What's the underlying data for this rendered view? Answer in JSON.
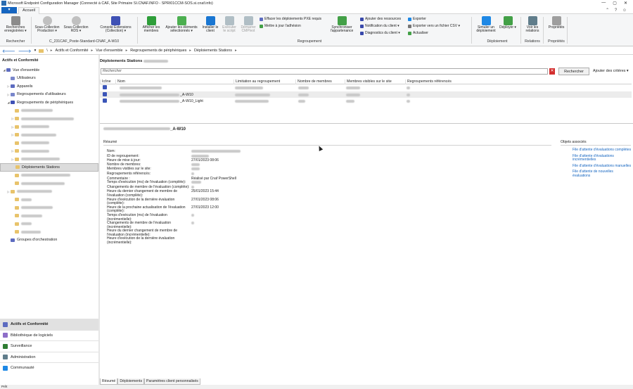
{
  "window": {
    "title": "Microsoft Endpoint Configuration Manager (Connecté à CAF, Site Primaire SI.CNAF.INFO - SPRI01CCM-SOS.si.cnaf.info)",
    "controls": [
      "—",
      "▢",
      "✕"
    ]
  },
  "ribbon_tabs": {
    "file": "▾",
    "home": "Accueil"
  },
  "ribbon": {
    "buttons": [
      {
        "label": "Recherches enregistrées ▾",
        "icon": "saved-search-icon",
        "color": "#8b8b8b"
      },
      {
        "label": "Sous-Collection Production ▾",
        "icon": "subcollection-icon",
        "color": "#c0c0c0"
      },
      {
        "label": "Sous-Collection RDS ▾",
        "icon": "subcollection-rds-icon",
        "color": "#c0c0c0"
      },
      {
        "label": "Console Extensions (Collection) ▾",
        "icon": "console-extensions-icon",
        "color": "#3f51b5"
      },
      {
        "label": "Afficher les membres",
        "icon": "show-members-icon",
        "color": "#2e9e3a"
      },
      {
        "label": "Ajouter les éléments sélectionnés ▾",
        "icon": "add-items-icon",
        "color": "#4caf50"
      },
      {
        "label": "Installer le client",
        "icon": "install-client-icon",
        "color": "#1976d2"
      },
      {
        "label": "Exécuter le script",
        "icon": "run-script-icon",
        "color": "#b0bec5"
      },
      {
        "label": "Démarrer CMPivot",
        "icon": "cmpivot-icon",
        "color": "#b0bec5"
      },
      {
        "label": "Synchroniser l'appartenance",
        "icon": "sync-icon",
        "color": "#43a047"
      },
      {
        "label": "Simuler un déploiement",
        "icon": "simulate-icon",
        "color": "#1e88e5"
      },
      {
        "label": "Déployer ▾",
        "icon": "deploy-icon",
        "color": "#43a047"
      },
      {
        "label": "Voir les relations",
        "icon": "relations-icon",
        "color": "#607d8b"
      },
      {
        "label": "Propriétés",
        "icon": "properties-icon",
        "color": "#9e9e9e"
      }
    ],
    "small": [
      {
        "label": "Effacer les déploiements PXE requis",
        "icon": "pxe-icon",
        "color": "#5c6bc0"
      },
      {
        "label": "Mettre à jour l'adhésion",
        "icon": "update-icon",
        "color": "#43a047"
      },
      {
        "label": "Ajouter des ressources",
        "icon": "add-resources-icon",
        "color": "#3949ab"
      },
      {
        "label": "Notification du client ▾",
        "icon": "notify-icon",
        "color": "#3949ab"
      },
      {
        "label": "Diagnostics du client ▾",
        "icon": "diagnostics-icon",
        "color": "#3949ab"
      },
      {
        "label": "Exporter",
        "icon": "export-icon",
        "color": "#1e88e5"
      },
      {
        "label": "Exporter vers un fichier CSV ▾",
        "icon": "csv-icon",
        "color": "#757575"
      },
      {
        "label": "Actualiser",
        "icon": "refresh-icon",
        "color": "#43a047"
      }
    ],
    "groups": [
      "Rechercher",
      "Regroupement",
      "Déploiement",
      "Relations",
      "Propriétés"
    ],
    "context": "C_231CAF_Poste-Standard-CNAF_A-W10"
  },
  "addressbar": {
    "path": [
      "\\",
      "Actifs et Conformité",
      "Vue d'ensemble",
      "Regroupements de périphériques",
      "Déploiements Stations"
    ]
  },
  "left": {
    "header": "Actifs et Conformité",
    "tree": [
      {
        "label": "Vue d'ensemble",
        "indent": 0,
        "arrow": "◢",
        "color": "#5c6bc0"
      },
      {
        "label": "Utilisateurs",
        "indent": 1,
        "arrow": "",
        "color": "#7986cb"
      },
      {
        "label": "Appareils",
        "indent": 1,
        "arrow": "▷",
        "color": "#5c6bc0"
      },
      {
        "label": "Regroupements d'utilisateurs",
        "indent": 1,
        "arrow": "▷",
        "color": "#7986cb"
      },
      {
        "label": "Regroupements de périphériques",
        "indent": 1,
        "arrow": "◢",
        "color": "#3f51b5"
      },
      {
        "label": "",
        "indent": 2,
        "arrow": "",
        "folder": true,
        "blur": 45
      },
      {
        "label": "",
        "indent": 2,
        "arrow": "▷",
        "folder": true,
        "blur": 75
      },
      {
        "label": "",
        "indent": 2,
        "arrow": "▷",
        "folder": true,
        "blur": 40
      },
      {
        "label": "",
        "indent": 2,
        "arrow": "▷",
        "folder": true,
        "blur": 50
      },
      {
        "label": "",
        "indent": 2,
        "arrow": "",
        "folder": true,
        "blur": 40
      },
      {
        "label": "",
        "indent": 2,
        "arrow": "▷",
        "folder": true,
        "blur": 40
      },
      {
        "label": "",
        "indent": 2,
        "arrow": "▷",
        "folder": true,
        "blur": 55
      },
      {
        "label": "Déploiements Stations",
        "indent": 2,
        "arrow": "",
        "folder": true,
        "selected": true
      },
      {
        "label": "",
        "indent": 2,
        "arrow": "",
        "folder": true,
        "blur": 70
      },
      {
        "label": "",
        "indent": 2,
        "arrow": "",
        "folder": true,
        "blur": 62
      },
      {
        "label": "",
        "indent": 1,
        "arrow": "▷",
        "folder": true,
        "blur": 50
      },
      {
        "label": "",
        "indent": 2,
        "arrow": "",
        "folder": true,
        "blur": 15
      },
      {
        "label": "",
        "indent": 2,
        "arrow": "",
        "folder": true,
        "blur": 45
      },
      {
        "label": "",
        "indent": 2,
        "arrow": "",
        "folder": true,
        "blur": 30
      },
      {
        "label": "",
        "indent": 2,
        "arrow": "",
        "folder": true,
        "blur": 15
      },
      {
        "label": "",
        "indent": 2,
        "arrow": "",
        "folder": true,
        "blur": 28
      },
      {
        "label": "Groupes d'orchestration",
        "indent": 1,
        "arrow": "",
        "color": "#5c6bc0"
      }
    ],
    "workspaces": [
      {
        "label": "Actifs et Conformité",
        "color": "#5c6bc0",
        "selected": true
      },
      {
        "label": "Bibliothèque de logiciels",
        "color": "#8e6ec8"
      },
      {
        "label": "Surveillance",
        "color": "#2e7d32"
      },
      {
        "label": "Administration",
        "color": "#607d8b"
      },
      {
        "label": "Communauté",
        "color": "#1e88e5"
      }
    ]
  },
  "main": {
    "title": "Déploiements Stations",
    "search_placeholder": "Rechercher",
    "search_clear": "✕",
    "search_button": "Rechercher",
    "add_criteria": "Ajouter des critères ▾",
    "columns": [
      "Icône",
      "Nom",
      "Limitation au regroupement",
      "Nombre de membres",
      "Membres visibles sur le site",
      "Regroupements référencés"
    ],
    "rows": [
      {
        "name_suffix": "",
        "b": [
          60,
          40,
          15,
          20,
          5
        ]
      },
      {
        "name_suffix": "_A-W10",
        "b": [
          85,
          50,
          15,
          20,
          5
        ]
      },
      {
        "name_suffix": "_A-W10_Light",
        "b": [
          85,
          48,
          10,
          12,
          5
        ]
      }
    ],
    "detail": {
      "title_suffix": "_A-W10",
      "section": "Résumé",
      "props": [
        {
          "label": "Nom:",
          "value": "",
          "blur": 70
        },
        {
          "label": "ID de regroupement:",
          "value": "",
          "blur": 25
        },
        {
          "label": "Heure de mise à jour:",
          "value": "27/01/2023 08:06"
        },
        {
          "label": "Nombre de membres:",
          "value": "",
          "blur": 12
        },
        {
          "label": "Membres visibles sur le site:",
          "value": "",
          "blur": 12
        },
        {
          "label": "Regroupements référencés:",
          "value": "",
          "blur": 4
        },
        {
          "label": "Commentaire :",
          "value": "Réalisé par Cnaf PowerShell"
        },
        {
          "label": "Temps d'exécution (ms) de l'évaluation (complète):",
          "value": "",
          "blur": 14
        },
        {
          "label": "Changements de membre de l'évaluation (complète):",
          "value": "",
          "blur": 4
        },
        {
          "label": "Heure du dernier changement de membre de l'évaluation (complète):",
          "value": "25/01/2023 15:44"
        },
        {
          "label": "Heure d'exécution de la dernière évaluation (complète):",
          "value": "27/01/2023 08:06"
        },
        {
          "label": "Heure de la prochaine actualisation de l'évaluation (complète):",
          "value": "27/01/2023 12:00"
        },
        {
          "label": "Temps d'exécution (ms) de l'évaluation (incrémentielle):",
          "value": "",
          "blur": 4
        },
        {
          "label": "Changements de membre de l'évaluation (incrémentielle):",
          "value": "",
          "blur": 4
        },
        {
          "label": "Heure du dernier changement de membre de l'évaluation (incrémentielle):",
          "value": ""
        },
        {
          "label": "Heure d'exécution de la dernière évaluation (incrémentielle):",
          "value": ""
        }
      ],
      "related_header": "Objets associés",
      "related": [
        "File d'attente d'évaluations complètes",
        "File d'attente d'évaluations incrémentielles",
        "File d'attente d'évaluations manuelles",
        "File d'attente de nouvelles évaluations"
      ]
    },
    "bottom_tabs": [
      "Résumé",
      "Déploiements",
      "Paramètres client personnalisés"
    ]
  },
  "status": "Prêt"
}
